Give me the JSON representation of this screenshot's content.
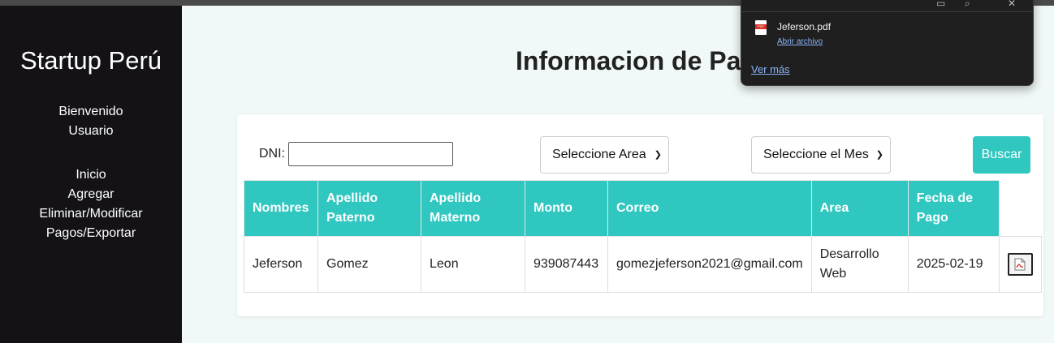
{
  "sidebar": {
    "brand": "Startup Perú",
    "welcome_line1": "Bienvenido",
    "welcome_line2": "Usuario",
    "nav": [
      "Inicio",
      "Agregar",
      "Eliminar/Modificar",
      "Pagos/Exportar"
    ]
  },
  "page": {
    "title": "Informacion de Pag"
  },
  "filters": {
    "dni_label": "DNI:",
    "dni_value": "",
    "area_select": "Seleccione Area",
    "mes_select": "Seleccione el Mes",
    "search_button": "Buscar"
  },
  "table": {
    "headers": [
      [
        "Nombres"
      ],
      [
        "Apellido",
        "Paterno"
      ],
      [
        "Apellido",
        "Materno"
      ],
      [
        "Monto"
      ],
      [
        "Correo"
      ],
      [
        "Area"
      ],
      [
        "Fecha de",
        "Pago"
      ]
    ],
    "rows": [
      {
        "nombres": "Jeferson",
        "apellido_paterno": "Gomez",
        "apellido_materno": "Leon",
        "monto": "939087443",
        "correo": "gomezjeferson2021@gmail.com",
        "area_line1": "Desarrollo",
        "area_line2": "Web",
        "fecha": "2025-02-19"
      }
    ]
  },
  "download_popup": {
    "filename": "Jeferson.pdf",
    "open_link": "Abrir archivo",
    "see_more": "Ver más",
    "file_badge": "PDF"
  },
  "colors": {
    "accent": "#2fc7c0",
    "sidebar_bg": "#141217",
    "page_bg": "#f1f8f8",
    "link": "#8ab4f8"
  }
}
